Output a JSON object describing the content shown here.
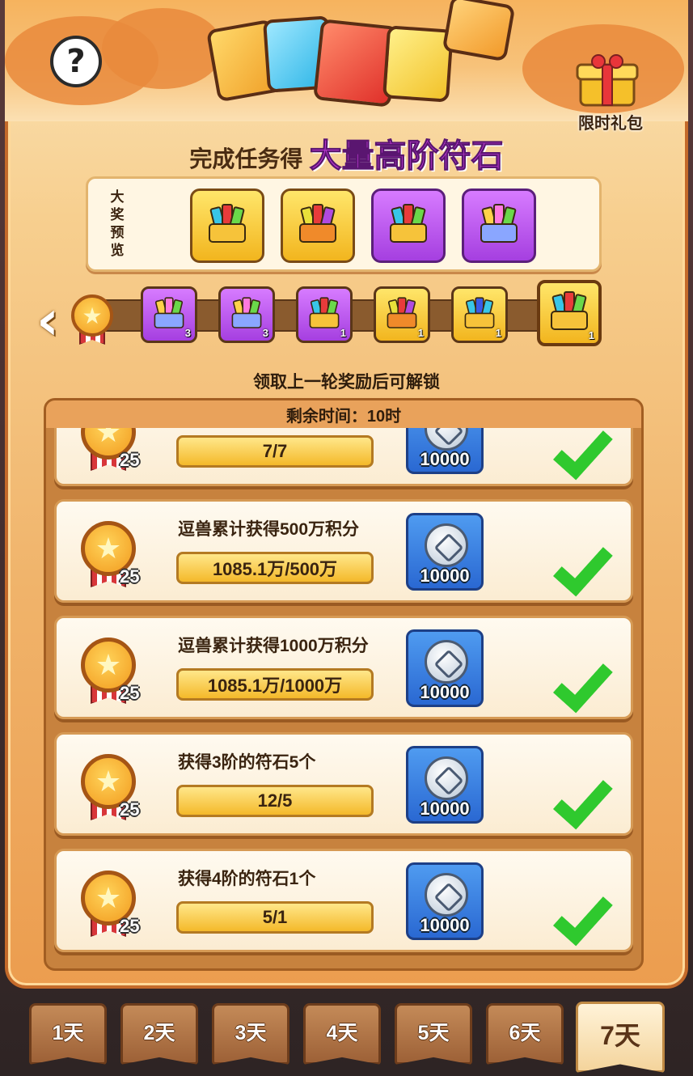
{
  "header": {
    "help_symbol": "?",
    "gift_label": "限时礼包"
  },
  "headline": {
    "prefix": "完成任务得",
    "highlight": "大量高阶符石"
  },
  "preview": {
    "label": "大奖预览",
    "prizes": [
      {
        "style": "gold"
      },
      {
        "style": "gold"
      },
      {
        "style": "purple"
      },
      {
        "style": "purple"
      }
    ]
  },
  "track": {
    "nodes": [
      {
        "style": "purple",
        "count": "3"
      },
      {
        "style": "purple",
        "count": "3"
      },
      {
        "style": "purple",
        "count": "1"
      },
      {
        "style": "gold",
        "count": "1"
      },
      {
        "style": "gold",
        "count": "1"
      },
      {
        "style": "gold",
        "count": "1"
      }
    ],
    "unlock_text": "领取上一轮奖励后可解锁"
  },
  "timer": "剩余时间：10时",
  "tasks": [
    {
      "title": "",
      "progress": "7/7",
      "medal": "25",
      "reward": "10000",
      "done": true
    },
    {
      "title": "逗兽累计获得500万积分",
      "progress": "1085.1万/500万",
      "medal": "25",
      "reward": "10000",
      "done": true
    },
    {
      "title": "逗兽累计获得1000万积分",
      "progress": "1085.1万/1000万",
      "medal": "25",
      "reward": "10000",
      "done": true
    },
    {
      "title": "获得3阶的符石5个",
      "progress": "12/5",
      "medal": "25",
      "reward": "10000",
      "done": true
    },
    {
      "title": "获得4阶的符石1个",
      "progress": "5/1",
      "medal": "25",
      "reward": "10000",
      "done": true
    }
  ],
  "days": [
    "1天",
    "2天",
    "3天",
    "4天",
    "5天",
    "6天",
    "7天"
  ],
  "active_day": 6,
  "colors": {
    "accent_purple": "#c23ad8",
    "check_green": "#2fc92e",
    "coin_blue": "#2a68d2"
  }
}
